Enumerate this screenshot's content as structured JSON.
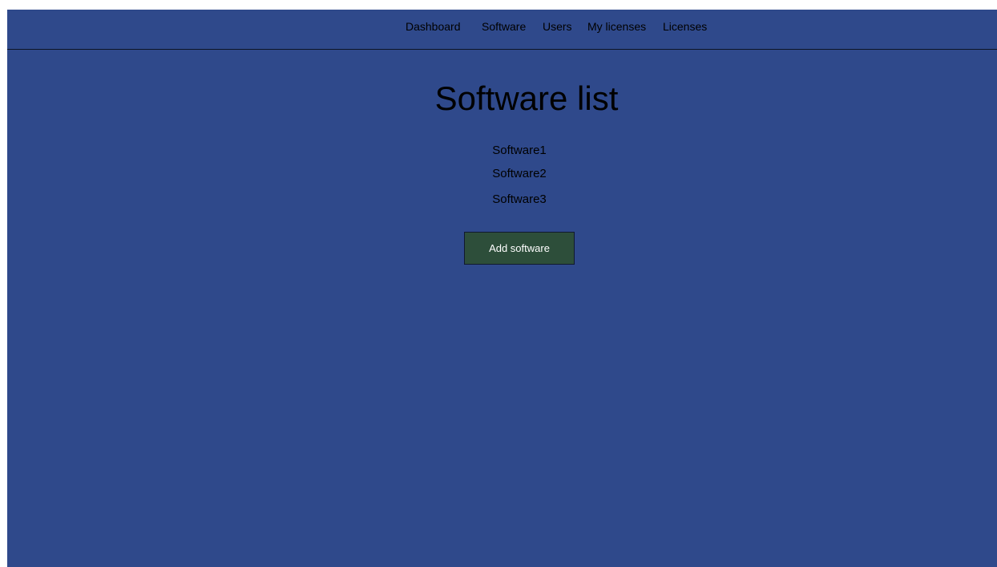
{
  "nav": {
    "dashboard": "Dashboard",
    "software": "Software",
    "users": "Users",
    "my_licenses": "My licenses",
    "licenses": "Licenses"
  },
  "main": {
    "title": "Software list",
    "items": [
      "Software1",
      "Software2",
      "Software3"
    ],
    "add_button": "Add software"
  },
  "colors": {
    "background": "#2f498b",
    "button": "#2d4e3a",
    "text": "#000000"
  }
}
